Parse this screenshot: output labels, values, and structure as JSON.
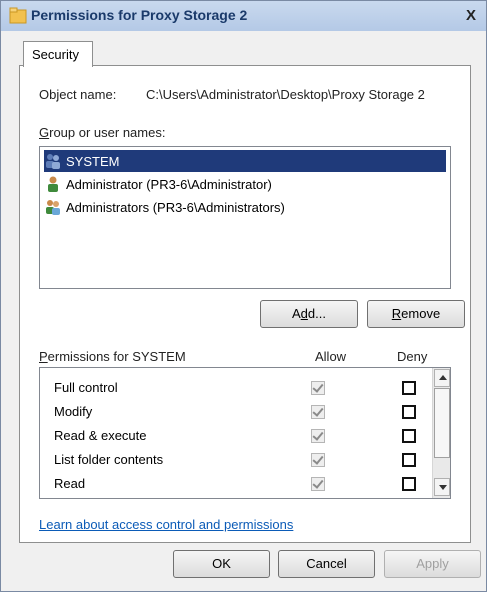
{
  "window": {
    "title": "Permissions for Proxy Storage 2",
    "close": "X"
  },
  "tabs": [
    {
      "label": "Security"
    }
  ],
  "object": {
    "label": "Object name:",
    "value": "C:\\Users\\Administrator\\Desktop\\Proxy Storage 2"
  },
  "group_users": {
    "label_underlined": "G",
    "label_rest": "roup or user names:",
    "items": [
      {
        "name": "SYSTEM",
        "icon": "group-users-icon",
        "selected": true
      },
      {
        "name": "Administrator (PR3-6\\Administrator)",
        "icon": "user-icon",
        "selected": false
      },
      {
        "name": "Administrators (PR3-6\\Administrators)",
        "icon": "group-users-icon",
        "selected": false
      }
    ]
  },
  "buttons": {
    "add": {
      "pre": "A",
      "u": "d",
      "post": "d..."
    },
    "remove": {
      "u": "R",
      "post": "emove"
    },
    "ok": "OK",
    "cancel": "Cancel",
    "apply": "Apply"
  },
  "permissions": {
    "label_underlined": "P",
    "label_rest": "ermissions for SYSTEM",
    "col_allow": "Allow",
    "col_deny": "Deny",
    "rows": [
      {
        "name": "Full control",
        "allow": true,
        "deny": false
      },
      {
        "name": "Modify",
        "allow": true,
        "deny": false
      },
      {
        "name": "Read & execute",
        "allow": true,
        "deny": false
      },
      {
        "name": "List folder contents",
        "allow": true,
        "deny": false
      },
      {
        "name": "Read",
        "allow": true,
        "deny": false
      }
    ]
  },
  "link": "Learn about access control and permissions",
  "colors": {
    "selection": "#1f3a7a",
    "link": "#0b5bb7",
    "folder": "#f2c14e"
  }
}
